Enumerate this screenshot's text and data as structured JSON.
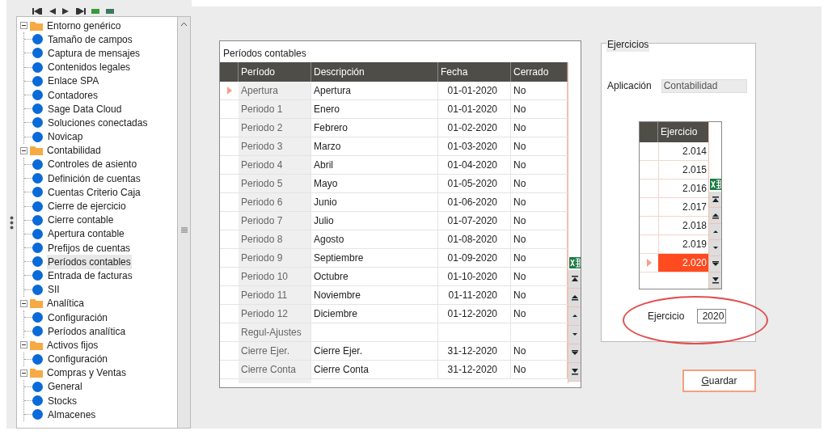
{
  "tree": [
    {
      "label": "Entorno genérico",
      "expanded": true,
      "children": [
        {
          "label": "Tamaño de campos",
          "selected": false
        },
        {
          "label": "Captura de mensajes",
          "selected": false
        },
        {
          "label": "Contenidos legales",
          "selected": false
        },
        {
          "label": "Enlace SPA",
          "selected": false
        },
        {
          "label": "Contadores",
          "selected": false
        },
        {
          "label": "Sage Data Cloud",
          "selected": false
        },
        {
          "label": "Soluciones conectadas",
          "selected": false
        },
        {
          "label": "Novicap",
          "selected": false
        }
      ]
    },
    {
      "label": "Contabilidad",
      "expanded": true,
      "children": [
        {
          "label": "Controles de asiento",
          "selected": false
        },
        {
          "label": "Definición de cuentas",
          "selected": false
        },
        {
          "label": "Cuentas Criterio Caja",
          "selected": false
        },
        {
          "label": "Cierre de ejercicio",
          "selected": false
        },
        {
          "label": "Cierre contable",
          "selected": false
        },
        {
          "label": "Apertura contable",
          "selected": false
        },
        {
          "label": "Prefijos de cuentas",
          "selected": false
        },
        {
          "label": "Períodos contables",
          "selected": true
        },
        {
          "label": "Entrada de facturas",
          "selected": false
        },
        {
          "label": "SII",
          "selected": false
        }
      ]
    },
    {
      "label": "Analítica",
      "expanded": true,
      "children": [
        {
          "label": "Configuración",
          "selected": false
        },
        {
          "label": "Períodos analítica",
          "selected": false
        }
      ]
    },
    {
      "label": "Activos fijos",
      "expanded": true,
      "children": [
        {
          "label": "Configuración",
          "selected": false
        }
      ]
    },
    {
      "label": "Compras y Ventas",
      "expanded": true,
      "children": [
        {
          "label": "General",
          "selected": false
        },
        {
          "label": "Stocks",
          "selected": false
        },
        {
          "label": "Almacenes",
          "selected": false
        }
      ]
    }
  ],
  "periods_panel": {
    "title": "Períodos contables",
    "columns": [
      "Período",
      "Descripción",
      "Fecha",
      "Cerrado"
    ],
    "rows": [
      {
        "periodo": "Apertura",
        "descripcion": "Apertura",
        "fecha": "01-01-2020",
        "cerrado": "No",
        "current": true
      },
      {
        "periodo": "Periodo 1",
        "descripcion": "Enero",
        "fecha": "01-01-2020",
        "cerrado": "No",
        "current": false
      },
      {
        "periodo": "Periodo 2",
        "descripcion": "Febrero",
        "fecha": "01-02-2020",
        "cerrado": "No",
        "current": false
      },
      {
        "periodo": "Periodo 3",
        "descripcion": "Marzo",
        "fecha": "01-03-2020",
        "cerrado": "No",
        "current": false
      },
      {
        "periodo": "Periodo 4",
        "descripcion": "Abril",
        "fecha": "01-04-2020",
        "cerrado": "No",
        "current": false
      },
      {
        "periodo": "Periodo 5",
        "descripcion": "Mayo",
        "fecha": "01-05-2020",
        "cerrado": "No",
        "current": false
      },
      {
        "periodo": "Periodo 6",
        "descripcion": "Junio",
        "fecha": "01-06-2020",
        "cerrado": "No",
        "current": false
      },
      {
        "periodo": "Periodo 7",
        "descripcion": "Julio",
        "fecha": "01-07-2020",
        "cerrado": "No",
        "current": false
      },
      {
        "periodo": "Periodo 8",
        "descripcion": "Agosto",
        "fecha": "01-08-2020",
        "cerrado": "No",
        "current": false
      },
      {
        "periodo": "Periodo 9",
        "descripcion": "Septiembre",
        "fecha": "01-09-2020",
        "cerrado": "No",
        "current": false
      },
      {
        "periodo": "Periodo 10",
        "descripcion": "Octubre",
        "fecha": "01-10-2020",
        "cerrado": "No",
        "current": false
      },
      {
        "periodo": "Periodo 11",
        "descripcion": "Noviembre",
        "fecha": "01-11-2020",
        "cerrado": "No",
        "current": false
      },
      {
        "periodo": "Periodo 12",
        "descripcion": "Diciembre",
        "fecha": "01-12-2020",
        "cerrado": "No",
        "current": false
      },
      {
        "periodo": "Regul-Ajustes",
        "current": false
      },
      {
        "periodo": "Cierre Ejer.",
        "descripcion": "Cierre Ejer.",
        "fecha": "31-12-2020",
        "cerrado": "No",
        "current": false
      },
      {
        "periodo": "Cierre Conta",
        "descripcion": "Cierre Conta",
        "fecha": "31-12-2020",
        "cerrado": "No",
        "current": false
      }
    ]
  },
  "exercises_group": {
    "title": "Ejercicios",
    "application_label": "Aplicación",
    "application_value": "Contabilidad",
    "column": "Ejercicio",
    "rows": [
      {
        "value": "2.014",
        "selected": false
      },
      {
        "value": "2.015",
        "selected": false
      },
      {
        "value": "2.016",
        "selected": false
      },
      {
        "value": "2.017",
        "selected": false
      },
      {
        "value": "2.018",
        "selected": false
      },
      {
        "value": "2.019",
        "selected": false
      },
      {
        "value": "2.020",
        "selected": true
      }
    ],
    "exercise_label": "Ejercicio",
    "exercise_value": "2020"
  },
  "save_button": "Guardar"
}
